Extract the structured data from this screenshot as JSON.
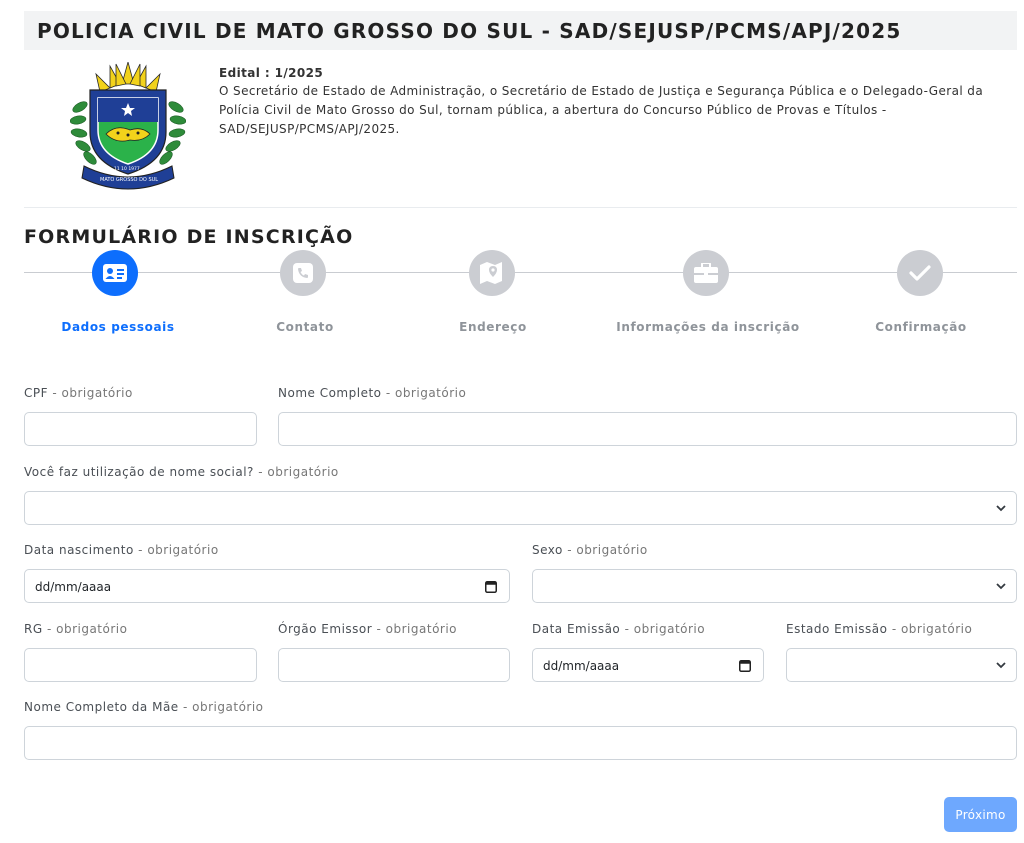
{
  "header": {
    "title": "POLICIA CIVIL DE MATO GROSSO DO SUL - SAD/SEJUSP/PCMS/APJ/2025"
  },
  "crest": {
    "ribbon_text": "MATO GROSSO DO SUL",
    "date_text": "11 10 1977"
  },
  "edital": {
    "title": "Edital : 1/2025",
    "text": "O Secretário de Estado de Administração, o Secretário de Estado de Justiça e Segurança Pública e o Delegado-Geral da Polícia Civil de Mato Grosso do Sul, tornam pública, a abertura do Concurso Público de Provas e Títulos - SAD/SEJUSP/PCMS/APJ/2025."
  },
  "form": {
    "title": "FORMULÁRIO DE INSCRIÇÃO",
    "steps": [
      {
        "label": "Dados pessoais",
        "icon": "id-card-icon",
        "active": true
      },
      {
        "label": "Contato",
        "icon": "phone-icon",
        "active": false
      },
      {
        "label": "Endereço",
        "icon": "map-icon",
        "active": false
      },
      {
        "label": "Informações da inscrição",
        "icon": "briefcase-icon",
        "active": false
      },
      {
        "label": "Confirmação",
        "icon": "check-icon",
        "active": false
      }
    ],
    "required_suffix": "- obrigatório",
    "fields": {
      "cpf": {
        "label": "CPF",
        "value": ""
      },
      "nome": {
        "label": "Nome Completo",
        "value": ""
      },
      "nome_social": {
        "label": "Você faz utilização de nome social?",
        "value": ""
      },
      "nascimento": {
        "label": "Data nascimento",
        "value": "dd/mm/aaaa"
      },
      "sexo": {
        "label": "Sexo",
        "value": ""
      },
      "rg": {
        "label": "RG",
        "value": ""
      },
      "orgao": {
        "label": "Órgão Emissor",
        "value": ""
      },
      "data_emissao": {
        "label": "Data Emissão",
        "value": "dd/mm/aaaa"
      },
      "estado_emissao": {
        "label": "Estado Emissão",
        "value": ""
      },
      "mae": {
        "label": "Nome Completo da Mãe",
        "value": ""
      }
    },
    "next_label": "Próximo"
  },
  "colors": {
    "primary": "#0d6efd",
    "inactive_step": "#cbcdd2",
    "button": "#6ea8fe"
  }
}
